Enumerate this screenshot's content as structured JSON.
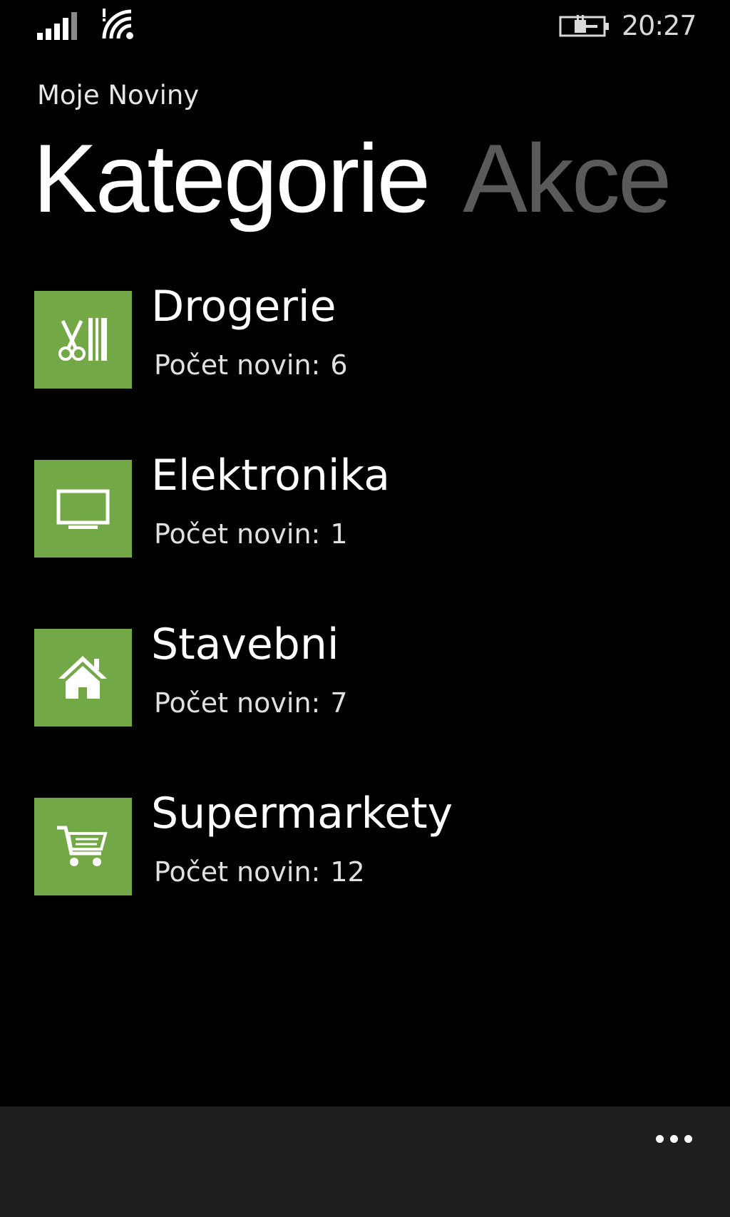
{
  "status_bar": {
    "time": "20:27",
    "signal_icon": "signal-bars-icon",
    "wifi_icon": "wifi-icon",
    "battery_icon": "battery-charging-icon"
  },
  "header": {
    "app_title": "Moje Noviny",
    "pivots": [
      {
        "label": "Kategorie",
        "active": true
      },
      {
        "label": "Akce",
        "active": false
      }
    ]
  },
  "categories": [
    {
      "name": "Drogerie",
      "count_label": "Počet novin:",
      "count": "6",
      "icon": "scissors-comb-icon"
    },
    {
      "name": "Elektronika",
      "count_label": "Počet novin:",
      "count": "1",
      "icon": "monitor-icon"
    },
    {
      "name": "Stavebni",
      "count_label": "Počet novin:",
      "count": "7",
      "icon": "house-icon"
    },
    {
      "name": "Supermarkety",
      "count_label": "Počet novin:",
      "count": "12",
      "icon": "shopping-cart-icon"
    }
  ],
  "app_bar": {
    "more_icon": "ellipsis-icon"
  },
  "colors": {
    "accent": "#72a845",
    "background": "#000000",
    "app_bar": "#1f1f1f",
    "inactive_pivot": "#5a5a5a"
  }
}
